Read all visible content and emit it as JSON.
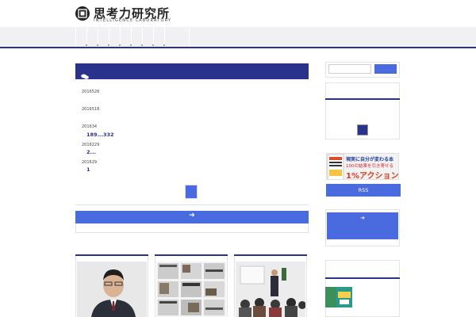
{
  "header": {
    "logo_title": "思考力研究所",
    "logo_subtitle": "INTELLIGENCE LABORATORY"
  },
  "news": [
    {
      "date": "2016526",
      "title": ""
    },
    {
      "date": "2016518",
      "title": ""
    },
    {
      "date": "201634",
      "title": "189...332"
    },
    {
      "date": "2016229",
      "title": "2..."
    },
    {
      "date": "201629",
      "title": "1"
    }
  ],
  "sidebar": {
    "search_placeholder": "",
    "rss_label": "RSS",
    "banner": {
      "line1": "現実に自分が変わる本",
      "line2": "100の結果を引き寄せる",
      "line3": "1%アクション"
    }
  },
  "colors": {
    "brand": "#29338b",
    "accent": "#4a6adf",
    "nav_bg": "#f1f1f3"
  }
}
